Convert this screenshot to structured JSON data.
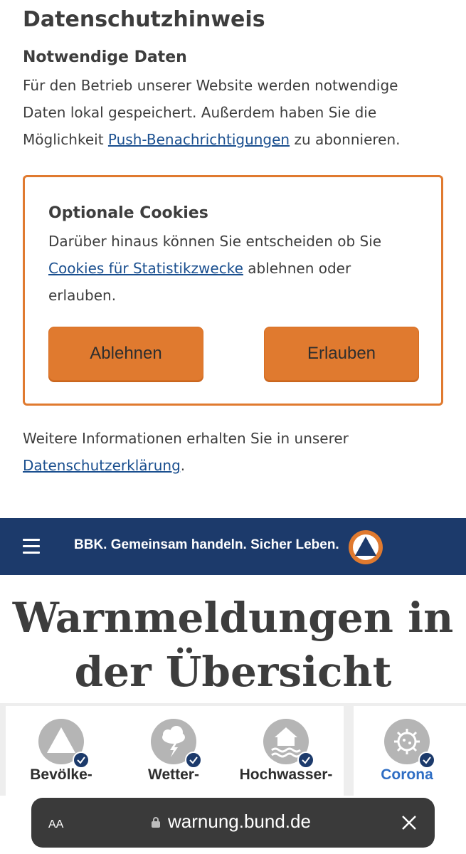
{
  "privacy": {
    "title": "Datenschutzhinweis",
    "required_title": "Notwendige Daten",
    "required_text_1": "Für den Betrieb unserer Website werden notwendige Daten lokal gespeichert. Außerdem haben Sie die Möglichkeit ",
    "push_link": "Push-Benachrichtigungen",
    "required_text_2": " zu abonnieren.",
    "optional_title": "Optionale Cookies",
    "optional_text_1": "Darüber hinaus können Sie entscheiden ob Sie ",
    "cookies_link": "Cookies für Statistikzwecke",
    "optional_text_2": " ablehnen oder erlauben.",
    "decline_label": "Ablehnen",
    "allow_label": "Erlauben",
    "more_text_1": "Weitere Informationen erhalten Sie in unserer ",
    "privacy_link": "Datenschutzerklärung",
    "more_text_2": "."
  },
  "navbar": {
    "slogan": "BBK. Gemeinsam handeln. Sicher Leben.",
    "menu_icon": "hamburger-icon",
    "logo_icon": "bbk-triangle-logo"
  },
  "main": {
    "headline": "Warnmeldungen in der Übersicht"
  },
  "tiles": [
    {
      "label": "Bevölke-",
      "icon": "warning-triangle-icon",
      "checked": true
    },
    {
      "label": "Wetter-",
      "icon": "thunderstorm-icon",
      "checked": true
    },
    {
      "label": "Hochwasser-",
      "icon": "flood-house-icon",
      "checked": true
    },
    {
      "label": "Corona",
      "icon": "virus-icon",
      "checked": true,
      "active": true
    }
  ],
  "browser": {
    "aa_label": "AA",
    "url": "warnung.bund.de"
  },
  "colors": {
    "accent_orange": "#e07a2f",
    "navy": "#1c3a6b",
    "link_blue": "#1a4f8f",
    "active_blue": "#2f6ec4"
  }
}
